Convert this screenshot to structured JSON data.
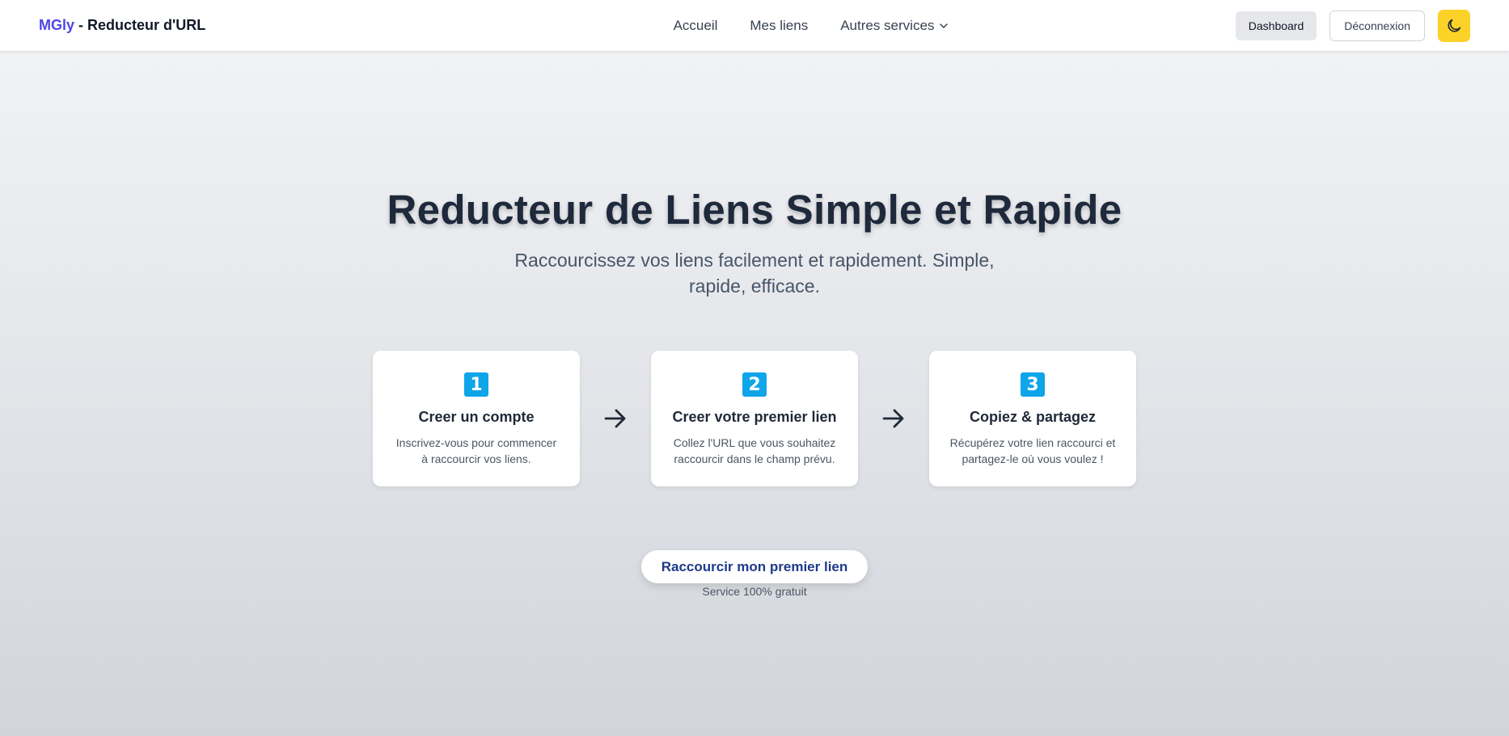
{
  "brand": {
    "accent": "MGly",
    "rest": " - Reducteur d'URL"
  },
  "nav": {
    "items": [
      {
        "label": "Accueil"
      },
      {
        "label": "Mes liens"
      },
      {
        "label": "Autres services"
      }
    ]
  },
  "actions": {
    "dashboard": "Dashboard",
    "logout": "Déconnexion",
    "theme_icon": "moon-icon"
  },
  "hero": {
    "title": "Reducteur de Liens Simple et Rapide",
    "subtitle": "Raccourcissez vos liens facilement et rapidement. Simple, rapide, efficace."
  },
  "steps": [
    {
      "number": "1",
      "title": "Creer un compte",
      "description": "Inscrivez-vous pour commencer à raccourcir vos liens."
    },
    {
      "number": "2",
      "title": "Creer votre premier lien",
      "description": "Collez l'URL que vous souhaitez raccourcir dans le champ prévu."
    },
    {
      "number": "3",
      "title": "Copiez & partagez",
      "description": "Récupérez votre lien raccourci et partagez-le où vous voulez !"
    }
  ],
  "cta": {
    "label": "Raccourcir mon premier lien",
    "note": "Service 100% gratuit"
  },
  "colors": {
    "brand_accent": "#4f46e5",
    "step_badge": "#0ea5e9",
    "theme_button": "#fcd228",
    "cta_text": "#1e3a8a"
  }
}
